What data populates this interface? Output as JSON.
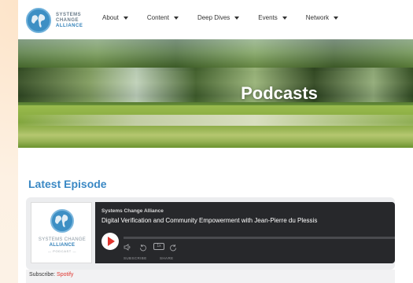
{
  "logo": {
    "line1": "SYSTEMS",
    "line2": "CHANGE",
    "line3": "ALLIANCE"
  },
  "nav": {
    "items": [
      {
        "label": "About"
      },
      {
        "label": "Content"
      },
      {
        "label": "Deep Dives"
      },
      {
        "label": "Events"
      },
      {
        "label": "Network"
      }
    ]
  },
  "hero": {
    "title": "Podcasts"
  },
  "section": {
    "title": "Latest Episode"
  },
  "player": {
    "art_line1": "SYSTEMS CHANGE",
    "art_line2": "ALLIANCE",
    "art_line3": "— PODCAST —",
    "show_name": "Systems Change Alliance",
    "episode_title": "Digital Verification and Community Empowerment with Jean-Pierre du Plessis",
    "speed_label": "1x",
    "subscribe_label": "SUBSCRIBE",
    "share_label": "SHARE",
    "progress_fraction": 0
  },
  "subscribe": {
    "prefix": "Subscribe: ",
    "link": "Spotify"
  },
  "colors": {
    "accent_blue": "#3a88c4",
    "spotify_red": "#e0342d",
    "player_dark": "#27282b"
  },
  "icons": {
    "volume": "speaker-icon",
    "rewind": "rewind-15-icon",
    "forward": "forward-30-icon",
    "play": "play-icon",
    "caret": "chevron-down-icon"
  }
}
